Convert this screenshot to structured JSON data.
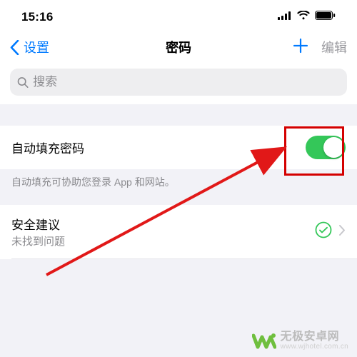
{
  "status": {
    "time": "15:16"
  },
  "nav": {
    "back_label": "设置",
    "title": "密码",
    "edit_label": "编辑"
  },
  "search": {
    "placeholder": "搜索"
  },
  "autofill": {
    "label": "自动填充密码",
    "footer": "自动填充可协助您登录 App 和网站。",
    "enabled": true
  },
  "recommendations": {
    "label": "安全建议",
    "detail": "未找到问题"
  },
  "colors": {
    "accent": "#007aff",
    "switch_on": "#34c759",
    "highlight": "#d40000",
    "arrow": "#e11818"
  },
  "watermark": {
    "text": "无极安卓网",
    "url": "www.wjhotel.com.cn"
  }
}
